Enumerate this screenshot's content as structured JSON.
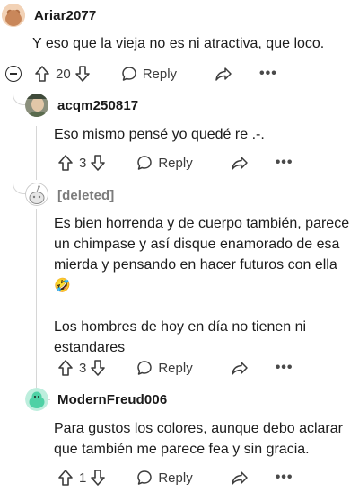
{
  "comments": [
    {
      "username": "Ariar2077",
      "body": [
        "Y eso que la vieja no es ni atractiva, que loco."
      ],
      "votes": "20",
      "reply_label": "Reply",
      "avatar_icon": "brown-avatar-icon"
    },
    {
      "username": "acqm250817",
      "body": [
        "Eso mismo pensé yo quedé re .-."
      ],
      "votes": "3",
      "reply_label": "Reply",
      "avatar_icon": "photo-avatar-icon"
    },
    {
      "username": "[deleted]",
      "body": [
        "Es bien horrenda y de cuerpo también, parece",
        "un chimpase y así disque enamorado de esa",
        "mierda y pensando en hacer futuros con ella",
        "🤣",
        "",
        "Los hombres de hoy en día no tienen ni",
        "estandares"
      ],
      "votes": "3",
      "reply_label": "Reply",
      "avatar_icon": "deleted-avatar-icon"
    },
    {
      "username": "ModernFreud006",
      "body": [
        "Para gustos los colores, aunque debo aclarar",
        "que también me parece fea y sin gracia."
      ],
      "votes": "1",
      "reply_label": "Reply",
      "avatar_icon": "green-avatar-icon"
    }
  ],
  "more_label": "•••",
  "colors": {
    "text": "#1c1c1c",
    "muted": "#4a4a4a",
    "thread": "#d6d6d6",
    "green_avatar": "#4fd1a5",
    "brown_avatar": "#c9875a"
  }
}
